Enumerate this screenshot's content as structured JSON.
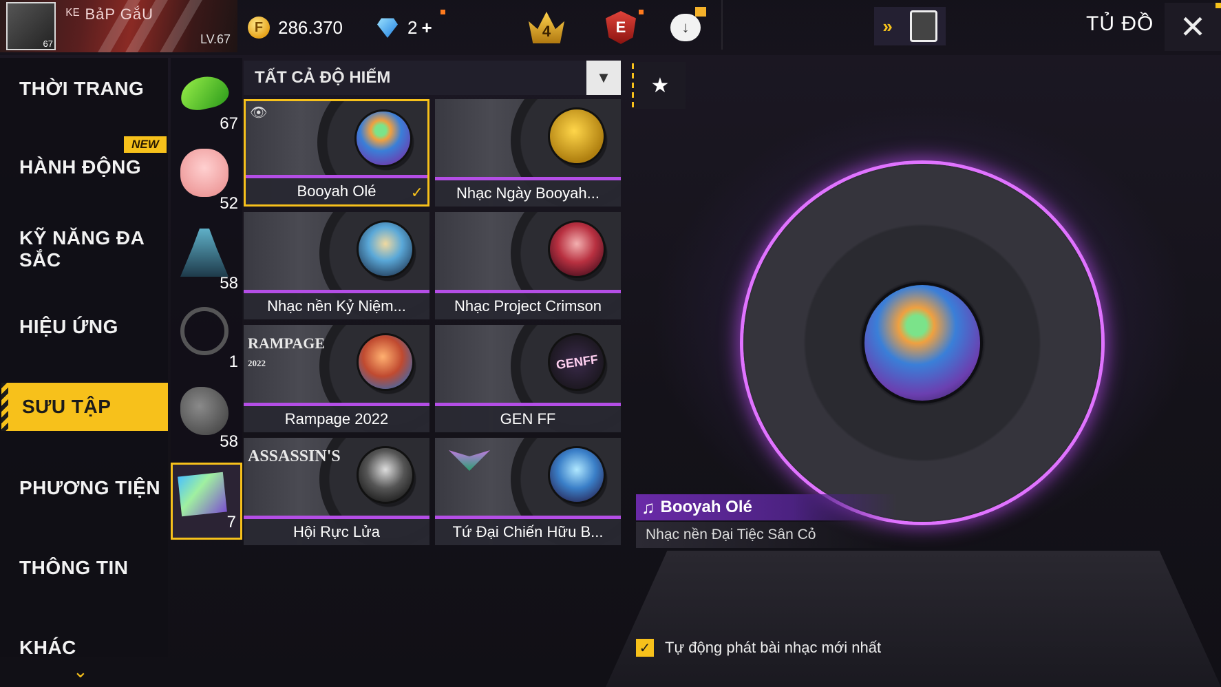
{
  "player": {
    "name": "ᴷᴱ BảP GắU",
    "avatar_level": "67",
    "level": "LV.67"
  },
  "currency": {
    "gold": "286.370",
    "diamonds": "2",
    "diamonds_add": "+"
  },
  "top_icons": {
    "rank_number": "4",
    "elite_letter": "E"
  },
  "header": {
    "title": "TỦ ĐỒ",
    "close": "✕"
  },
  "menu": {
    "items": [
      {
        "label": "THỜI TRANG"
      },
      {
        "label": "HÀNH ĐỘNG"
      },
      {
        "label": "KỸ NĂNG ĐA SẮC"
      },
      {
        "label": "HIỆU ỨNG"
      },
      {
        "label": "SƯU TẬP"
      },
      {
        "label": "PHƯƠNG TIỆN"
      },
      {
        "label": "THÔNG TIN"
      },
      {
        "label": "KHÁC"
      }
    ],
    "new_badge": "NEW",
    "active_index": 4
  },
  "subcategories": [
    {
      "count": "67",
      "icon": "skateboard-icon"
    },
    {
      "count": "52",
      "icon": "pig-pet-icon"
    },
    {
      "count": "58",
      "icon": "castle-icon"
    },
    {
      "count": "1",
      "icon": "weapon-ban-icon"
    },
    {
      "count": "58",
      "icon": "rock-icon"
    },
    {
      "count": "7",
      "icon": "music-disc-icon"
    }
  ],
  "filter": {
    "rarity_label": "TẤT CẢ ĐỘ HIẾM"
  },
  "grid": {
    "items": [
      {
        "name": "Booyah Olé"
      },
      {
        "name": "Nhạc Ngày Booyah..."
      },
      {
        "name": "Nhạc nền Kỷ Niệm..."
      },
      {
        "name": "Nhạc Project Crimson"
      },
      {
        "name": "Rampage 2022",
        "logo": "RAMPAGE",
        "logo_sub": "2022"
      },
      {
        "name": "GEN FF",
        "logo": "GENFF"
      },
      {
        "name": "Hội Rực Lửa",
        "logo": "ASSASSIN'S"
      },
      {
        "name": "Tứ Đại Chiến Hữu B..."
      }
    ],
    "selected_index": 0
  },
  "preview": {
    "title": "Booyah Olé",
    "subtitle": "Nhạc nền Đại Tiệc Sân Cỏ"
  },
  "autoplay": {
    "label": "Tự động phát bài nhạc mới nhất",
    "checked": true
  },
  "colors": {
    "accent": "#f7c11b",
    "purple": "#b44ee6"
  }
}
